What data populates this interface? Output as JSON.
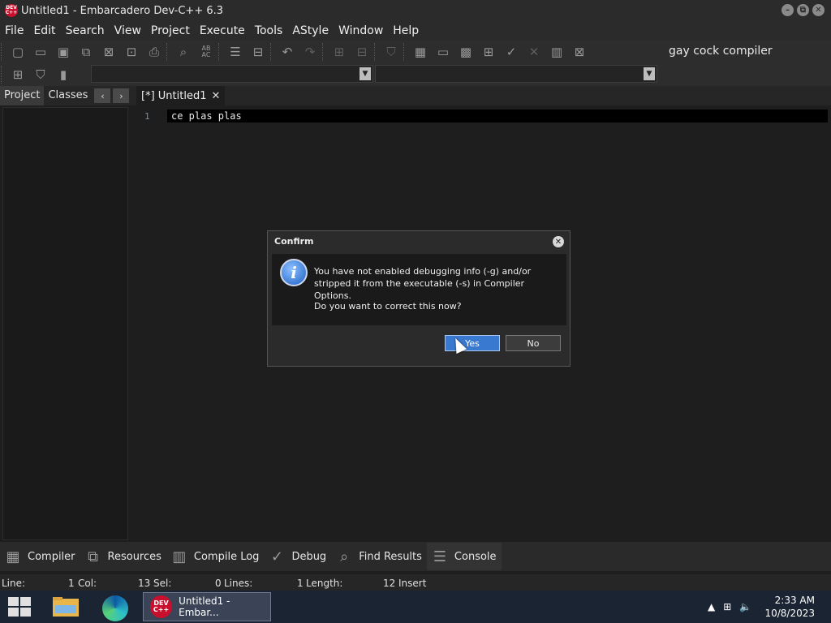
{
  "window": {
    "title": "Untitled1 - Embarcadero Dev-C++ 6.3",
    "logo_text": "DEV C++"
  },
  "menu": [
    "File",
    "Edit",
    "Search",
    "View",
    "Project",
    "Execute",
    "Tools",
    "AStyle",
    "Window",
    "Help"
  ],
  "toolbar": {
    "compiler_profile": "gay cock compiler"
  },
  "left_panel": {
    "tabs": [
      "Project",
      "Classes"
    ],
    "active_tab": "Project"
  },
  "editor": {
    "tab_label": "[*] Untitled1",
    "line_number": "1",
    "code": "ce plas plas"
  },
  "dialog": {
    "title": "Confirm",
    "message": "You have not enabled debugging info (-g) and/or stripped it from the executable (-s) in Compiler Options.",
    "question": "Do you want to correct this now?",
    "yes_label": "Yes",
    "no_label": "No"
  },
  "bottom_tabs": [
    {
      "label": "Compiler",
      "icon": "grid-icon"
    },
    {
      "label": "Resources",
      "icon": "resources-icon"
    },
    {
      "label": "Compile Log",
      "icon": "bar-chart-icon"
    },
    {
      "label": "Debug",
      "icon": "check-icon"
    },
    {
      "label": "Find Results",
      "icon": "find-icon"
    },
    {
      "label": "Console",
      "icon": "console-icon"
    }
  ],
  "status": {
    "line_label": "Line:",
    "line_value": "1",
    "col_label": "Col:",
    "col_value": "13",
    "sel_label": "Sel:",
    "sel_value": "0",
    "lines_label": "Lines:",
    "lines_value": "1",
    "length_label": "Length:",
    "length_value": "12",
    "mode": "Insert"
  },
  "taskbar": {
    "app_label": "Untitled1 - Embar...",
    "time": "2:33 AM",
    "date": "10/8/2023"
  }
}
